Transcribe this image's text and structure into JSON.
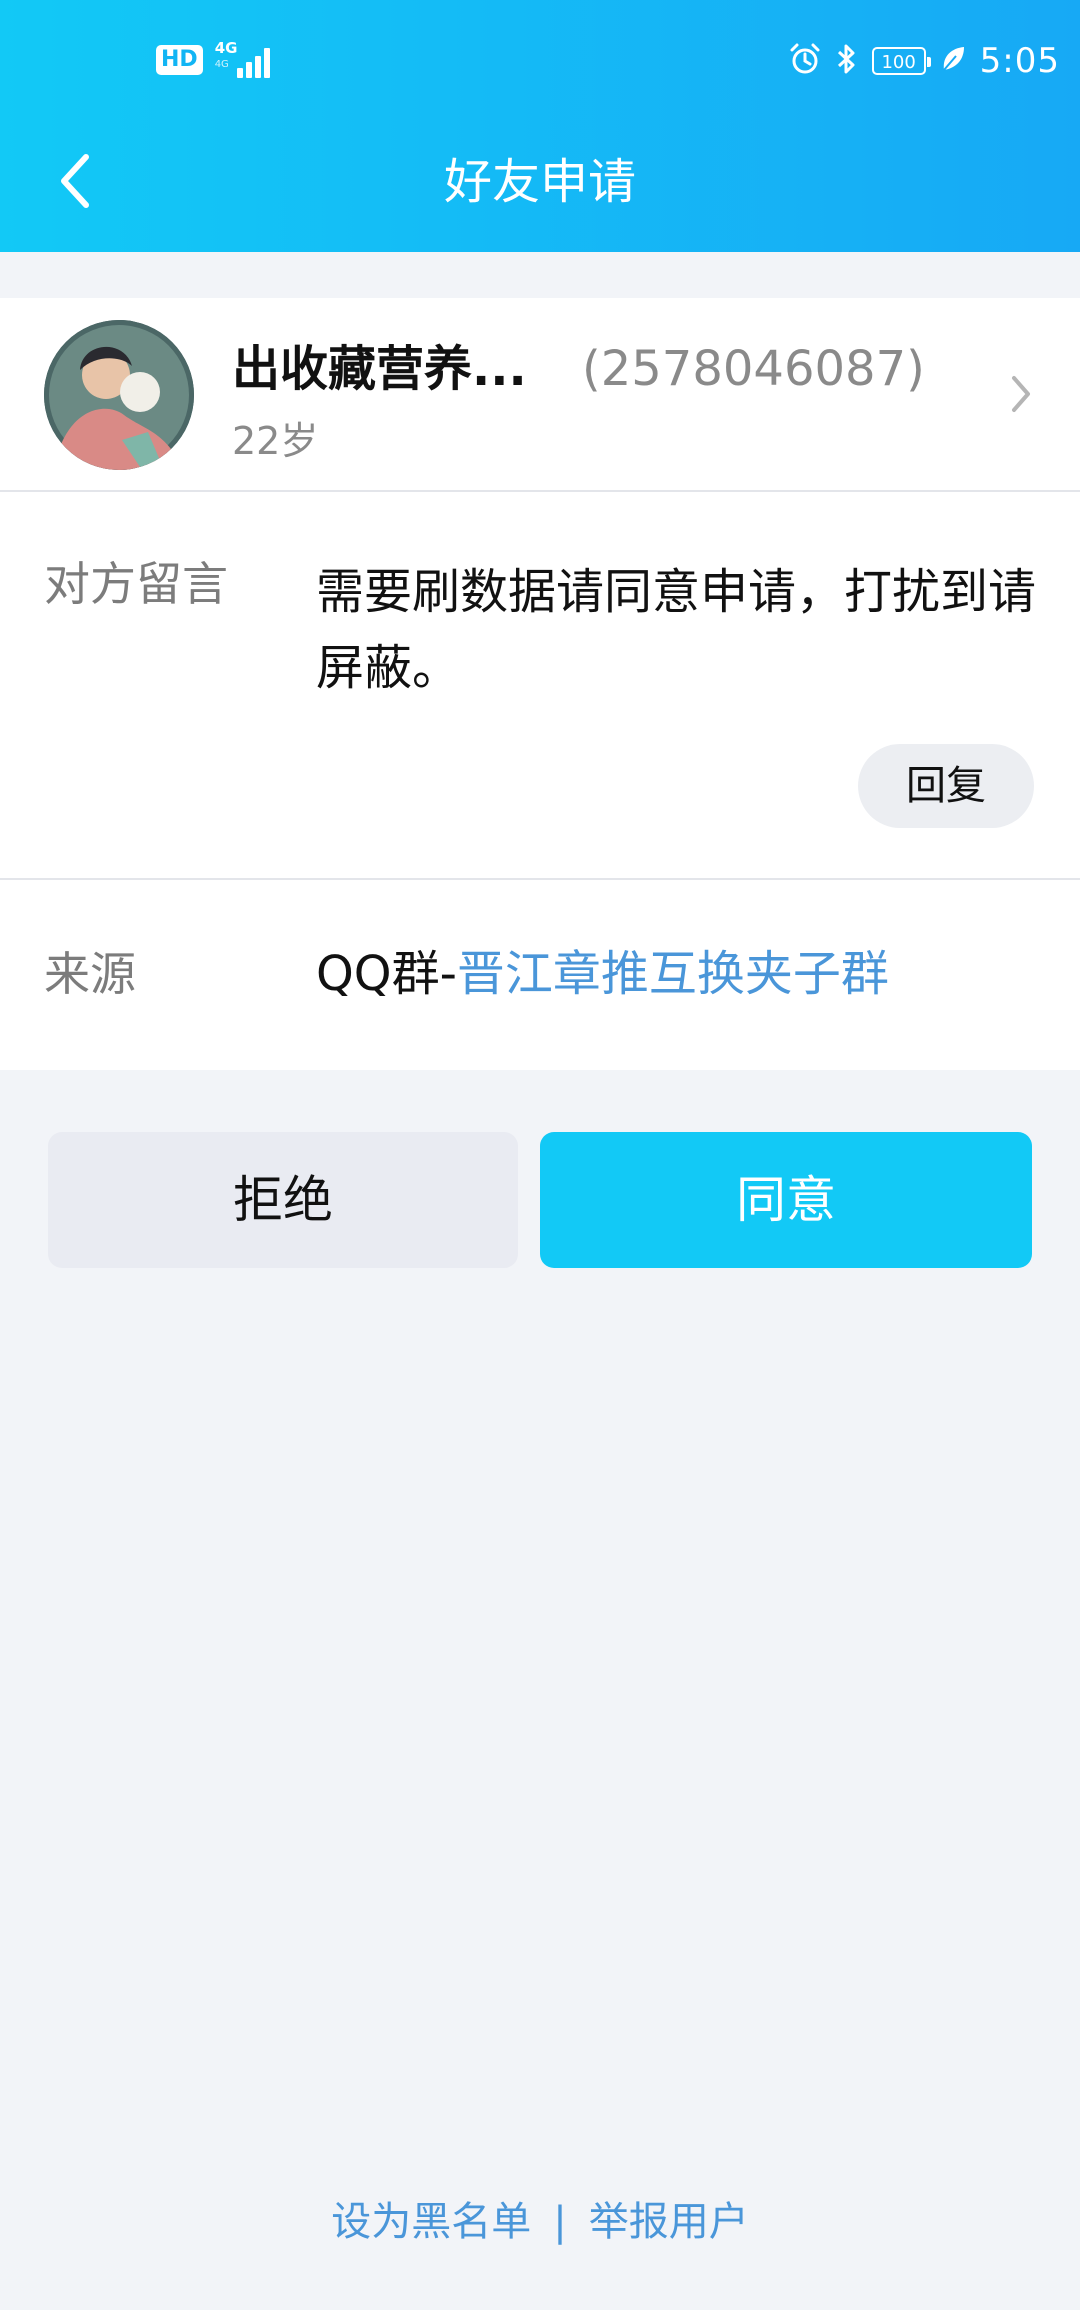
{
  "status_bar": {
    "hd": "HD",
    "network": "4G",
    "network_sub": "4G",
    "battery": "100",
    "time": "5:05",
    "icons": [
      "signal-icon",
      "alarm-icon",
      "bluetooth-icon",
      "battery-icon",
      "leaf-icon"
    ]
  },
  "nav": {
    "back_icon": "chevron-left-icon",
    "title": "好友申请"
  },
  "profile": {
    "nickname": "出收藏营养...",
    "uin": "(2578046087)",
    "age": "22岁",
    "chevron_icon": "chevron-right-icon"
  },
  "message": {
    "label": "对方留言",
    "text": "需要刷数据请同意申请，打扰到请屏蔽。",
    "reply_label": "回复"
  },
  "source": {
    "label": "来源",
    "prefix": "QQ群-",
    "group_name": "晋江章推互换夹子群"
  },
  "actions": {
    "reject_label": "拒绝",
    "accept_label": "同意"
  },
  "footer": {
    "blacklist_label": "设为黑名单",
    "separator": "|",
    "report_label": "举报用户"
  },
  "colors": {
    "header_start": "#12c9f6",
    "header_end": "#17a9f5",
    "accept": "#12c9f6",
    "link": "#4a96d9",
    "background": "#f2f4f8"
  }
}
